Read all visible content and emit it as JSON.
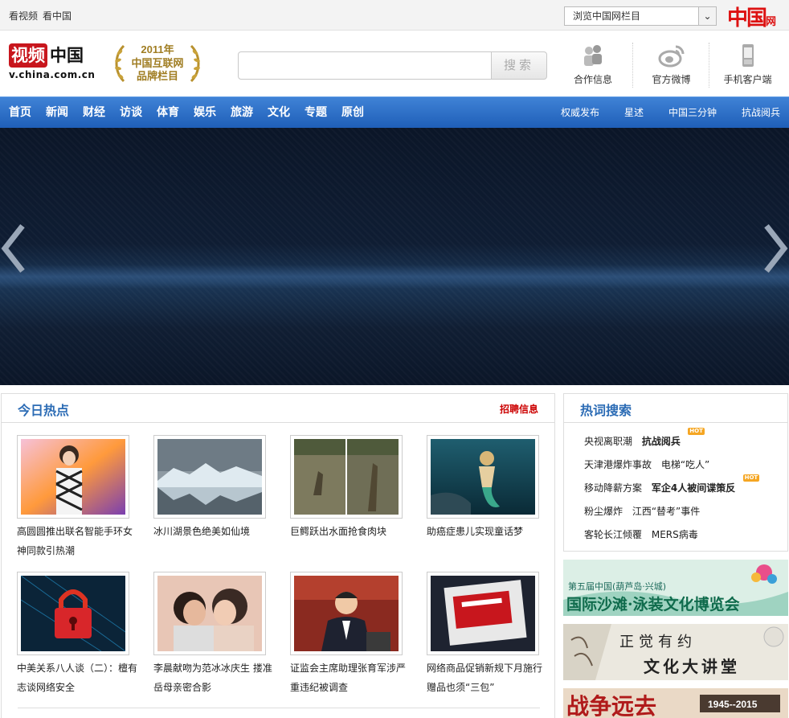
{
  "topbar": {
    "links": [
      "看视频",
      "看中国"
    ],
    "channel_select": "浏览中国网栏目",
    "china_logo": {
      "big": "中国",
      "small": "网"
    }
  },
  "header": {
    "logo": {
      "red": "视频",
      "black": "中国",
      "url": "v.china.com.cn"
    },
    "award": {
      "year": "2011年",
      "line1": "中国互联网",
      "line2": "品牌栏目"
    },
    "search": {
      "value": "",
      "button": "搜索"
    },
    "quick_links": [
      {
        "label": "合作信息",
        "icon": "cooperation-icon"
      },
      {
        "label": "官方微博",
        "icon": "weibo-icon"
      },
      {
        "label": "手机客户端",
        "icon": "mobile-icon"
      }
    ]
  },
  "nav": {
    "main": [
      "首页",
      "新闻",
      "财经",
      "访谈",
      "体育",
      "娱乐",
      "旅游",
      "文化",
      "专题",
      "原创"
    ],
    "right": [
      "权威发布",
      "星述",
      "中国三分钟",
      "抗战阅兵"
    ]
  },
  "hot_today": {
    "title": "今日热点",
    "job_link": "招聘信息",
    "items": [
      {
        "caption": "高圆圆推出联名智能手环女神同款引热潮"
      },
      {
        "caption": "冰川湖景色绝美如仙境"
      },
      {
        "caption": "巨鳄跃出水面抢食肉块"
      },
      {
        "caption": "助癌症患儿实现童话梦"
      },
      {
        "caption": "中美关系八人谈（二）：檀有志谈网络安全"
      },
      {
        "caption": "李晨献吻为范冰冰庆生 搂准岳母亲密合影"
      },
      {
        "caption": "证监会主席助理张育军涉严重违纪被调查"
      },
      {
        "caption": "网络商品促销新规下月施行 赠品也须“三包”"
      }
    ]
  },
  "hot_search": {
    "title": "热词搜索",
    "badge": "HOT",
    "rows": [
      [
        {
          "text": "央视离职潮",
          "strong": false
        },
        {
          "text": "抗战阅兵",
          "strong": true,
          "hot": true
        }
      ],
      [
        {
          "text": "天津港爆炸事故",
          "strong": false
        },
        {
          "text": "电梯“吃人”",
          "strong": false
        }
      ],
      [
        {
          "text": "移动降薪方案",
          "strong": false
        },
        {
          "text": "军企4人被间谍策反",
          "strong": true,
          "hot": true
        }
      ],
      [
        {
          "text": "粉尘爆炸",
          "strong": false
        },
        {
          "text": "江西“替考”事件",
          "strong": false
        }
      ],
      [
        {
          "text": "客轮长江倾覆",
          "strong": false
        },
        {
          "text": "MERS病毒",
          "strong": false
        }
      ]
    ]
  },
  "ads": [
    {
      "line1": "第五届中国(葫芦岛·兴城)",
      "line2": "国际沙滩·泳装文化博览会"
    },
    {
      "line1": "正觉有约",
      "line2": "文化大讲堂"
    },
    {
      "line1": "战争远去",
      "line2": "1945--2015"
    }
  ],
  "colors": {
    "nav_blue": "#2566c0",
    "title_blue": "#2c6cb5",
    "brand_red": "#c8161d",
    "hot_orange": "#f5a623"
  }
}
